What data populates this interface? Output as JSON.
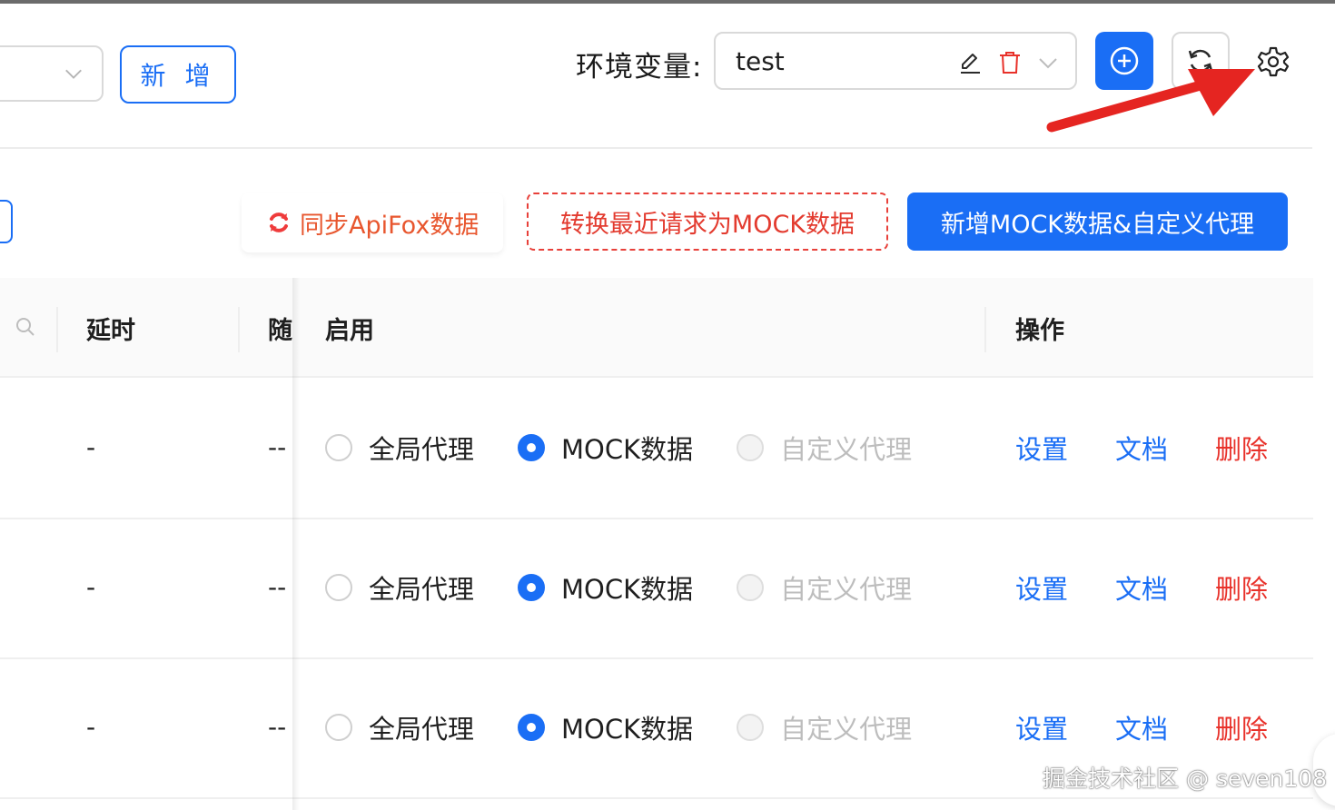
{
  "header": {
    "add_button_label": "新 增",
    "env_label": "环境变量:",
    "env_value": "test"
  },
  "toolbar": {
    "sync_label": "同步ApiFox数据",
    "convert_label": "转换最近请求为MOCK数据",
    "new_mock_label": "新增MOCK数据&自定义代理"
  },
  "table": {
    "columns": [
      "延时",
      "随",
      "启用",
      "操作"
    ],
    "rows": [
      {
        "delay": "-",
        "random": "--",
        "options": [
          "全局代理",
          "MOCK数据",
          "自定义代理"
        ],
        "selected": "MOCK数据",
        "actions": [
          "设置",
          "文档",
          "删除"
        ]
      },
      {
        "delay": "-",
        "random": "--",
        "options": [
          "全局代理",
          "MOCK数据",
          "自定义代理"
        ],
        "selected": "MOCK数据",
        "actions": [
          "设置",
          "文档",
          "删除"
        ]
      },
      {
        "delay": "-",
        "random": "--",
        "options": [
          "全局代理",
          "MOCK数据",
          "自定义代理"
        ],
        "selected": "MOCK数据",
        "actions": [
          "设置",
          "文档",
          "删除"
        ]
      }
    ]
  },
  "watermark": "掘金技术社区 @ seven108",
  "colors": {
    "primary": "#1a6ef5",
    "danger": "#e8312a",
    "sync_orange": "#e8562e",
    "arrow_red": "#e52521"
  },
  "icons": [
    "chevron-down-icon",
    "edit-icon",
    "trash-icon",
    "plus-circle-icon",
    "refresh-icon",
    "gear-icon",
    "sync-icon",
    "search-icon"
  ]
}
